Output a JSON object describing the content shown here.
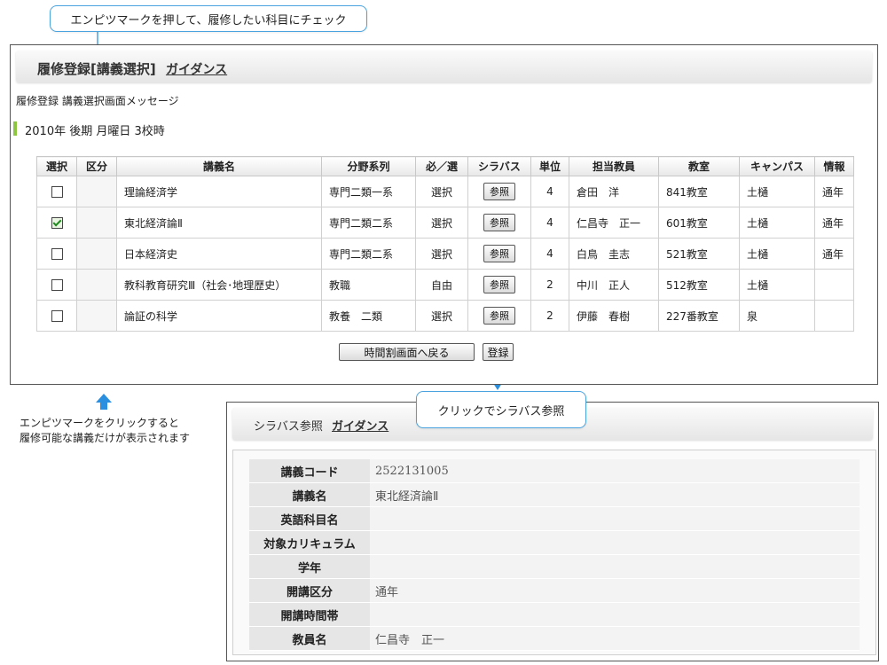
{
  "callouts": {
    "top": "エンピツマークを押して、履修したい科目にチェック",
    "left_line1": "エンピツマークをクリックすると",
    "left_line2": "履修可能な講義だけが表示されます",
    "syllabus": "クリックでシラバス参照"
  },
  "registration": {
    "title": "履修登録[講義選択]",
    "guidance_label": "ガイダンス",
    "message": "履修登録 講義選択画面メッセージ",
    "session": "2010年 後期 月曜日 3校時",
    "columns": [
      "選択",
      "区分",
      "講義名",
      "分野系列",
      "必／選",
      "シラバス",
      "単位",
      "担当教員",
      "教室",
      "キャンパス",
      "情報"
    ],
    "rows": [
      {
        "checked": false,
        "category": "",
        "course": "理論経済学",
        "field": "専門二類一系",
        "req": "選択",
        "syllabus": "参照",
        "units": "4",
        "teacher": "倉田　洋",
        "room": "841教室",
        "campus": "土樋",
        "info": "通年"
      },
      {
        "checked": true,
        "category": "",
        "course": "東北経済論Ⅱ",
        "field": "専門二類二系",
        "req": "選択",
        "syllabus": "参照",
        "units": "4",
        "teacher": "仁昌寺　正一",
        "room": "601教室",
        "campus": "土樋",
        "info": "通年"
      },
      {
        "checked": false,
        "category": "",
        "course": "日本経済史",
        "field": "専門二類二系",
        "req": "選択",
        "syllabus": "参照",
        "units": "4",
        "teacher": "白鳥　圭志",
        "room": "521教室",
        "campus": "土樋",
        "info": "通年"
      },
      {
        "checked": false,
        "category": "",
        "course": "教科教育研究Ⅲ（社会･地理歴史）",
        "field": "教職",
        "req": "自由",
        "syllabus": "参照",
        "units": "2",
        "teacher": "中川　正人",
        "room": "512教室",
        "campus": "土樋",
        "info": ""
      },
      {
        "checked": false,
        "category": "",
        "course": "論証の科学",
        "field": "教養　二類",
        "req": "選択",
        "syllabus": "参照",
        "units": "2",
        "teacher": "伊藤　春樹",
        "room": "227番教室",
        "campus": "泉",
        "info": ""
      }
    ],
    "back_button": "時間割画面へ戻る",
    "register_button": "登録"
  },
  "syllabus": {
    "title": "シラバス参照",
    "guidance_label": "ガイダンス",
    "fields": [
      {
        "label": "講義コード",
        "value": "2522131005"
      },
      {
        "label": "講義名",
        "value": "東北経済論Ⅱ"
      },
      {
        "label": "英語科目名",
        "value": ""
      },
      {
        "label": "対象カリキュラム",
        "value": ""
      },
      {
        "label": "学年",
        "value": ""
      },
      {
        "label": "開講区分",
        "value": "通年"
      },
      {
        "label": "開講時間帯",
        "value": ""
      },
      {
        "label": "教員名",
        "value": "仁昌寺　正一"
      }
    ]
  },
  "colors": {
    "accent": "#4aa3df",
    "arrow": "#2b8fe0",
    "session_marker": "#8cc63f"
  }
}
